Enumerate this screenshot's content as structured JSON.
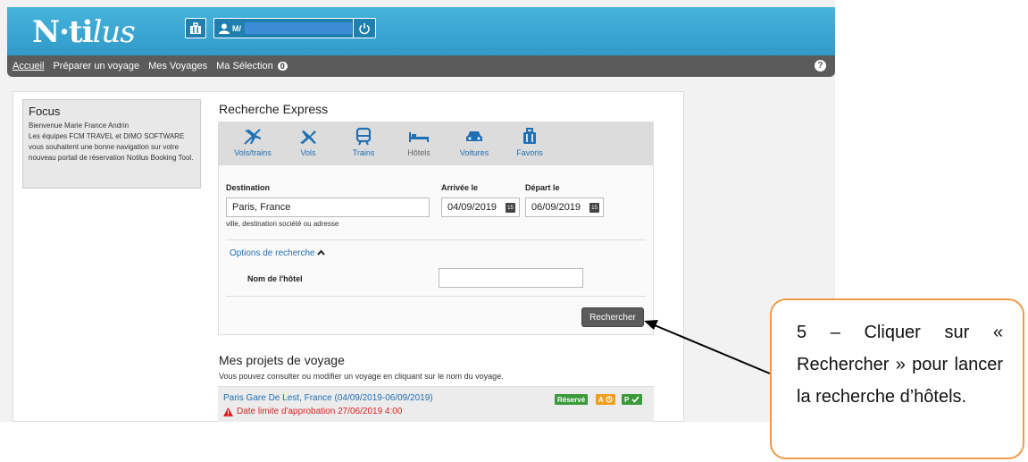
{
  "header": {
    "logo_text": "N·ti",
    "logo_swash": "lus",
    "user_initials": "M/",
    "colors": {
      "header_blue": "#3aa8d6",
      "nav_gray": "#5b5b5b",
      "link_blue": "#1f6fb4"
    }
  },
  "nav": {
    "items": [
      "Accueil",
      "Préparer un voyage",
      "Mes Voyages",
      "Ma Sélection"
    ],
    "selection_count": "0",
    "help": "?"
  },
  "focus": {
    "title": "Focus",
    "line1": "Bienvenue Marie France Andrin",
    "line2": "Les équipes FCM TRAVEL et DIMO SOFTWARE vous souhaitent une bonne navigation sur votre nouveau portail de réservation Notilus Booking Tool."
  },
  "search": {
    "title": "Recherche Express",
    "tabs": [
      {
        "label": "Vols/trains",
        "icon": "plane-train-icon"
      },
      {
        "label": "Vols",
        "icon": "plane-icon"
      },
      {
        "label": "Trains",
        "icon": "train-icon"
      },
      {
        "label": "Hôtels",
        "icon": "bed-icon"
      },
      {
        "label": "Voitures",
        "icon": "car-icon"
      },
      {
        "label": "Favoris",
        "icon": "suitcase-icon"
      }
    ],
    "destination_label": "Destination",
    "destination_value": "Paris, France",
    "destination_hint": "ville, destination société ou adresse",
    "arrival_label": "Arrivée le",
    "arrival_value": "04/09/2019",
    "departure_label": "Départ le",
    "departure_value": "06/09/2019",
    "calendar_day": "15",
    "options_label": "Options de recherche",
    "hotel_name_label": "Nom de l'hôtel",
    "hotel_name_value": "",
    "search_button": "Rechercher"
  },
  "projects": {
    "title": "Mes projets de voyage",
    "subtitle": "Vous pouvez consulter ou modifier un voyage en cliquant sur le nom du voyage.",
    "row_name": "Paris Gare De Lest, France (04/09/2019-06/09/2019)",
    "row_warning": "Date limite d'approbation 27/06/2019 4:00",
    "badge_reserved": "Réservé",
    "badge_a": "A",
    "badge_p": "P"
  },
  "callout": {
    "text": "5 – Cliquer sur « Rechercher » pour lancer la recherche d’hôtels."
  }
}
